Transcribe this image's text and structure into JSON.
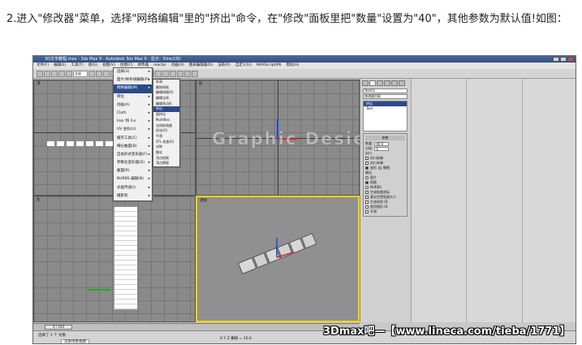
{
  "caption": "2.进入\"修改器\"菜单，选择\"网络编辑\"里的\"挤出\"命令，在\"修改\"面板里把\"数量\"设置为\"40\"，其他参数为默认值!如图：",
  "app": {
    "title": "3D文字教程.max - 3ds Max 9 - Autodesk 3ds Max 9 - 显示：Direct3D",
    "menus": [
      "文件(F)",
      "编辑(E)",
      "工具(T)",
      "组(G)",
      "视图(V)",
      "创建(C)",
      "修改器",
      "reactor",
      "动画(A)",
      "图表编辑器(D)",
      "渲染(R)",
      "自定义(U)",
      "MAXScript(M)",
      "帮助(H)"
    ],
    "toolbar_combo": "全部",
    "toolbar_combo2": "视图"
  },
  "viewports": {
    "top": "顶",
    "front": "前",
    "left": "左",
    "perspective": "透视"
  },
  "watermark": "Graphic Desien",
  "modifier_menu": {
    "items": [
      {
        "label": "选择(S)",
        "sub": true
      },
      {
        "label": "面片/样条线编辑(P)",
        "sub": true
      },
      {
        "label": "网格编辑(M)",
        "sub": true,
        "highlight": true
      },
      {
        "label": "转化",
        "sub": true
      },
      {
        "label": "动画(A)",
        "sub": true
      },
      {
        "label": "Cloth",
        "sub": true
      },
      {
        "label": "Hair 和 Fur",
        "sub": true
      },
      {
        "label": "UV 坐标(U)",
        "sub": true
      },
      {
        "label": "缓存工具(C)",
        "sub": true
      },
      {
        "label": "细分曲面(B)",
        "sub": true
      },
      {
        "label": "自由形式变形器(F)",
        "sub": true
      },
      {
        "label": "参数化变形器(D)",
        "sub": true
      },
      {
        "label": "曲面(R)",
        "sub": true
      },
      {
        "label": "NURBS 编辑(N)",
        "sub": true
      },
      {
        "label": "光能传递(I)",
        "sub": true
      },
      {
        "label": "摄影机",
        "sub": true
      }
    ]
  },
  "mesh_submenu": {
    "items": [
      "补洞",
      "删除网格",
      "编辑网格(E)",
      "编辑法线",
      "编辑多边形",
      "挤出",
      "面挤出",
      "MultiRes",
      "法线修改器",
      "优化(O)",
      "平滑",
      "STL 检查(S)",
      "对称",
      "细化",
      "顶点绘制",
      "顶点焊接"
    ],
    "highlight_index": 5
  },
  "command_panel": {
    "object_name": "Text01",
    "modifier_list": "修改器列表",
    "stack": [
      "挤出",
      "Text"
    ],
    "rollout_title": "参数",
    "amount_label": "数量:",
    "amount_value": "40.0",
    "segments_label": "分段:",
    "segments_value": "1",
    "capping_label": "封口",
    "cap_start": "封口始端",
    "cap_end": "封口末端",
    "morph": "变形",
    "grid": "栅格",
    "output_label": "输出",
    "out_patch": "面片",
    "out_mesh": "网格",
    "out_nurbs": "NURBS",
    "gen_mapping": "生成贴图坐标",
    "real_world": "真实世界贴图大小",
    "gen_material_ids": "生成材质 ID",
    "use_shape_ids": "使用图形 ID",
    "smooth": "平滑"
  },
  "timeline": {
    "slider": "0 / 100"
  },
  "status": {
    "selection": "选择了 1 个 对象",
    "prompt": "渲染场景视图",
    "coords": "X  Y  Z  栅格 = 10.0"
  },
  "forum_watermark": "3Dmax吧—【www.lineca.com/tieba/1771】"
}
